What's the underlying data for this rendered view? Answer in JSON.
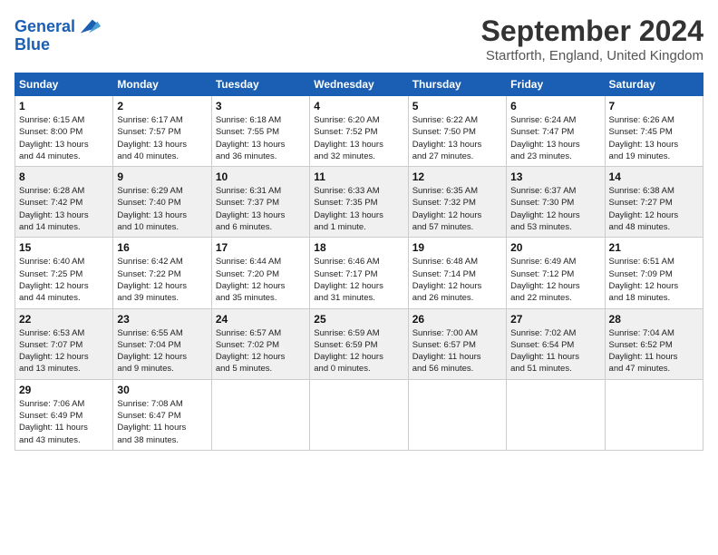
{
  "header": {
    "logo_line1": "General",
    "logo_line2": "Blue",
    "title": "September 2024",
    "subtitle": "Startforth, England, United Kingdom"
  },
  "weekdays": [
    "Sunday",
    "Monday",
    "Tuesday",
    "Wednesday",
    "Thursday",
    "Friday",
    "Saturday"
  ],
  "weeks": [
    [
      {
        "day": 1,
        "info": "Sunrise: 6:15 AM\nSunset: 8:00 PM\nDaylight: 13 hours\nand 44 minutes."
      },
      {
        "day": 2,
        "info": "Sunrise: 6:17 AM\nSunset: 7:57 PM\nDaylight: 13 hours\nand 40 minutes."
      },
      {
        "day": 3,
        "info": "Sunrise: 6:18 AM\nSunset: 7:55 PM\nDaylight: 13 hours\nand 36 minutes."
      },
      {
        "day": 4,
        "info": "Sunrise: 6:20 AM\nSunset: 7:52 PM\nDaylight: 13 hours\nand 32 minutes."
      },
      {
        "day": 5,
        "info": "Sunrise: 6:22 AM\nSunset: 7:50 PM\nDaylight: 13 hours\nand 27 minutes."
      },
      {
        "day": 6,
        "info": "Sunrise: 6:24 AM\nSunset: 7:47 PM\nDaylight: 13 hours\nand 23 minutes."
      },
      {
        "day": 7,
        "info": "Sunrise: 6:26 AM\nSunset: 7:45 PM\nDaylight: 13 hours\nand 19 minutes."
      }
    ],
    [
      {
        "day": 8,
        "info": "Sunrise: 6:28 AM\nSunset: 7:42 PM\nDaylight: 13 hours\nand 14 minutes."
      },
      {
        "day": 9,
        "info": "Sunrise: 6:29 AM\nSunset: 7:40 PM\nDaylight: 13 hours\nand 10 minutes."
      },
      {
        "day": 10,
        "info": "Sunrise: 6:31 AM\nSunset: 7:37 PM\nDaylight: 13 hours\nand 6 minutes."
      },
      {
        "day": 11,
        "info": "Sunrise: 6:33 AM\nSunset: 7:35 PM\nDaylight: 13 hours\nand 1 minute."
      },
      {
        "day": 12,
        "info": "Sunrise: 6:35 AM\nSunset: 7:32 PM\nDaylight: 12 hours\nand 57 minutes."
      },
      {
        "day": 13,
        "info": "Sunrise: 6:37 AM\nSunset: 7:30 PM\nDaylight: 12 hours\nand 53 minutes."
      },
      {
        "day": 14,
        "info": "Sunrise: 6:38 AM\nSunset: 7:27 PM\nDaylight: 12 hours\nand 48 minutes."
      }
    ],
    [
      {
        "day": 15,
        "info": "Sunrise: 6:40 AM\nSunset: 7:25 PM\nDaylight: 12 hours\nand 44 minutes."
      },
      {
        "day": 16,
        "info": "Sunrise: 6:42 AM\nSunset: 7:22 PM\nDaylight: 12 hours\nand 39 minutes."
      },
      {
        "day": 17,
        "info": "Sunrise: 6:44 AM\nSunset: 7:20 PM\nDaylight: 12 hours\nand 35 minutes."
      },
      {
        "day": 18,
        "info": "Sunrise: 6:46 AM\nSunset: 7:17 PM\nDaylight: 12 hours\nand 31 minutes."
      },
      {
        "day": 19,
        "info": "Sunrise: 6:48 AM\nSunset: 7:14 PM\nDaylight: 12 hours\nand 26 minutes."
      },
      {
        "day": 20,
        "info": "Sunrise: 6:49 AM\nSunset: 7:12 PM\nDaylight: 12 hours\nand 22 minutes."
      },
      {
        "day": 21,
        "info": "Sunrise: 6:51 AM\nSunset: 7:09 PM\nDaylight: 12 hours\nand 18 minutes."
      }
    ],
    [
      {
        "day": 22,
        "info": "Sunrise: 6:53 AM\nSunset: 7:07 PM\nDaylight: 12 hours\nand 13 minutes."
      },
      {
        "day": 23,
        "info": "Sunrise: 6:55 AM\nSunset: 7:04 PM\nDaylight: 12 hours\nand 9 minutes."
      },
      {
        "day": 24,
        "info": "Sunrise: 6:57 AM\nSunset: 7:02 PM\nDaylight: 12 hours\nand 5 minutes."
      },
      {
        "day": 25,
        "info": "Sunrise: 6:59 AM\nSunset: 6:59 PM\nDaylight: 12 hours\nand 0 minutes."
      },
      {
        "day": 26,
        "info": "Sunrise: 7:00 AM\nSunset: 6:57 PM\nDaylight: 11 hours\nand 56 minutes."
      },
      {
        "day": 27,
        "info": "Sunrise: 7:02 AM\nSunset: 6:54 PM\nDaylight: 11 hours\nand 51 minutes."
      },
      {
        "day": 28,
        "info": "Sunrise: 7:04 AM\nSunset: 6:52 PM\nDaylight: 11 hours\nand 47 minutes."
      }
    ],
    [
      {
        "day": 29,
        "info": "Sunrise: 7:06 AM\nSunset: 6:49 PM\nDaylight: 11 hours\nand 43 minutes."
      },
      {
        "day": 30,
        "info": "Sunrise: 7:08 AM\nSunset: 6:47 PM\nDaylight: 11 hours\nand 38 minutes."
      },
      null,
      null,
      null,
      null,
      null
    ]
  ]
}
